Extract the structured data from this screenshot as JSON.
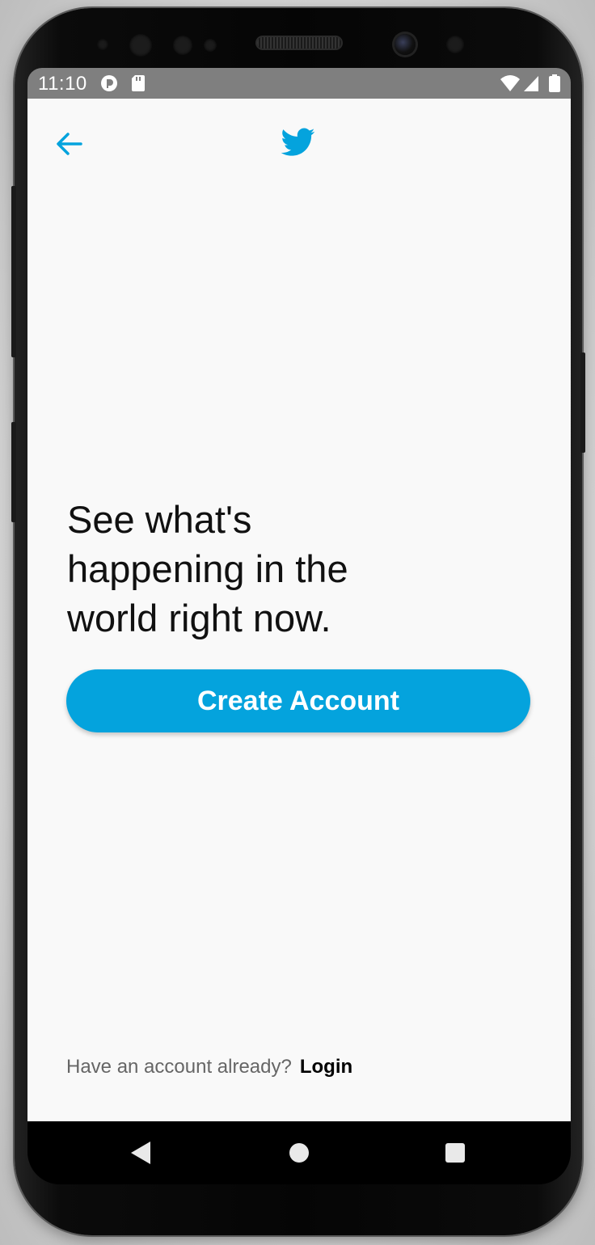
{
  "status_bar": {
    "time": "11:10",
    "left_icons": [
      "notification-app-icon",
      "sd-card-icon"
    ],
    "right_icons": [
      "wifi-icon",
      "signal-icon",
      "battery-icon"
    ]
  },
  "header": {
    "back_icon": "arrow-left-icon",
    "logo_icon": "twitter-bird-icon"
  },
  "main": {
    "headline_lines": [
      "See what's",
      "happening in the",
      "world right now."
    ],
    "create_account_label": "Create Account"
  },
  "footer": {
    "prompt": "Have an account already?",
    "login_label": "Login"
  },
  "nav_bar": {
    "icons": [
      "nav-back-icon",
      "nav-home-icon",
      "nav-recents-icon"
    ]
  },
  "colors": {
    "accent": "#04a3dd",
    "status_bar_bg": "#7f7f7f",
    "screen_bg": "#f9f9f9",
    "headline_text": "#111111",
    "footer_text": "#666666"
  }
}
